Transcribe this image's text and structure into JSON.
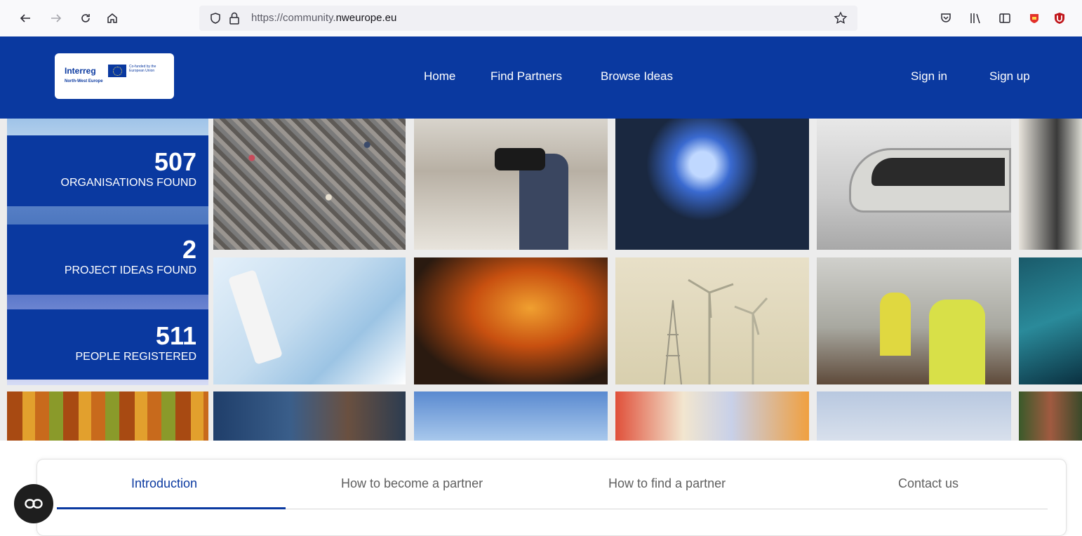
{
  "browser": {
    "url_prefix": "https://community.",
    "url_domain": "nweurope.eu",
    "icons": [
      "back-arrow-icon",
      "forward-arrow-icon",
      "reload-icon",
      "home-icon",
      "shield-icon",
      "lock-icon",
      "bookmark-star-icon",
      "pocket-icon",
      "library-icon",
      "sidebar-icon",
      "extension-icon",
      "ublock-icon"
    ]
  },
  "header": {
    "logo": {
      "wordmark": "Interreg",
      "cofunded": "Co-funded by the European Union",
      "region": "North-West Europe"
    },
    "nav": [
      "Home",
      "Find Partners",
      "Browse Ideas"
    ],
    "auth": {
      "sign_in": "Sign in",
      "sign_up": "Sign up"
    }
  },
  "stats": [
    {
      "value": "507",
      "label": "ORGANISATIONS FOUND"
    },
    {
      "value": "2",
      "label": "PROJECT IDEAS FOUND"
    },
    {
      "value": "511",
      "label": "PEOPLE REGISTERED"
    }
  ],
  "tabs": [
    {
      "label": "Introduction",
      "active": true
    },
    {
      "label": "How to become a partner",
      "active": false
    },
    {
      "label": "How to find a partner",
      "active": false
    },
    {
      "label": "Contact us",
      "active": false
    }
  ],
  "colors": {
    "brand": "#0a39a0",
    "chrome": "#f9f9fb",
    "url_bar": "#f0f0f4"
  }
}
